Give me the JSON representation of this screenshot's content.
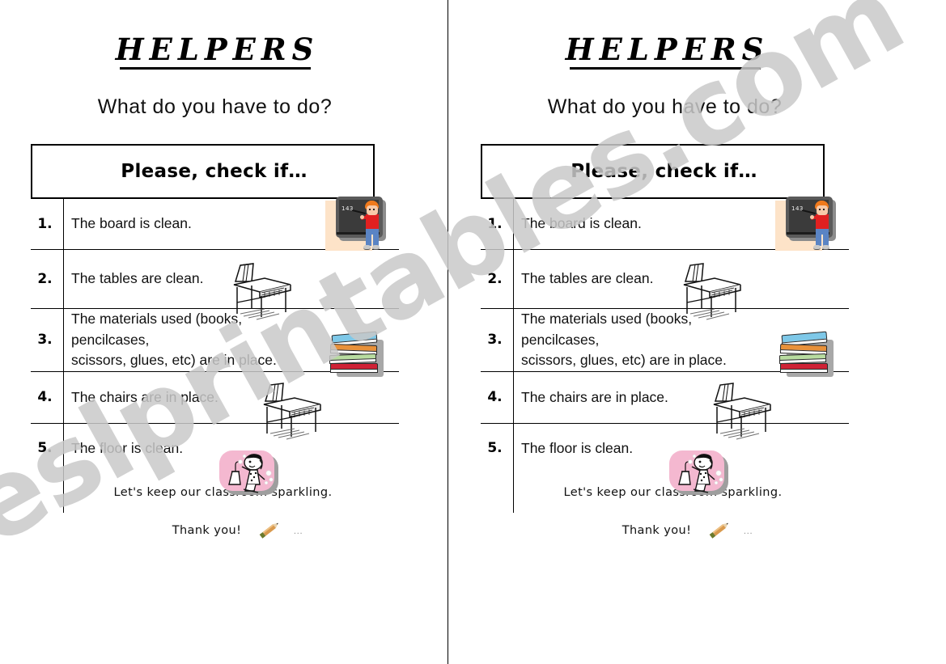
{
  "document": {
    "title": "HELPERS",
    "subtitle": "What do you have to do?",
    "header": "Please, check if…",
    "watermark": "eslprintables.com"
  },
  "checklist": {
    "items": [
      {
        "number": "1.",
        "text": "The board is clean.",
        "art": "blackboard-with-boy-clipart"
      },
      {
        "number": "2.",
        "text": "The tables are clean.",
        "art": "school-desk-clipart"
      },
      {
        "number": "3.",
        "text": "The materials used (books,\npencilcases,\nscissors, glues, etc) are in place.",
        "art": "stack-of-books-clipart"
      },
      {
        "number": "4.",
        "text": "The chairs are in place.",
        "art": "school-desk-clipart"
      },
      {
        "number": "5.",
        "text": "The floor is clean.",
        "art": "cleaning-girl-clipart"
      }
    ]
  },
  "footer": {
    "line1": "Let's keep our classroom sparkling.",
    "line2": "Thank you!",
    "trailing_dots": "…",
    "art": "pencil-clipart"
  },
  "colors": {
    "ink": "#000000",
    "body_text": "#111111",
    "watermark": "#c9c9c9",
    "board_slate": "#3b3b3b",
    "board_frame": "#5a5a5a",
    "board_cream": "#fde3c8",
    "boy_hair": "#f07a1c",
    "boy_shirt": "#e02020",
    "boy_jeans": "#5a84c4",
    "book_blue": "#7ec8e8",
    "book_orange": "#e8913a",
    "book_green": "#b8dca0",
    "book_red": "#cf2236",
    "clean_pink": "#f4b8d0",
    "pencil_body": "#d99a4e",
    "pencil_eraser": "#6b7a2e"
  }
}
